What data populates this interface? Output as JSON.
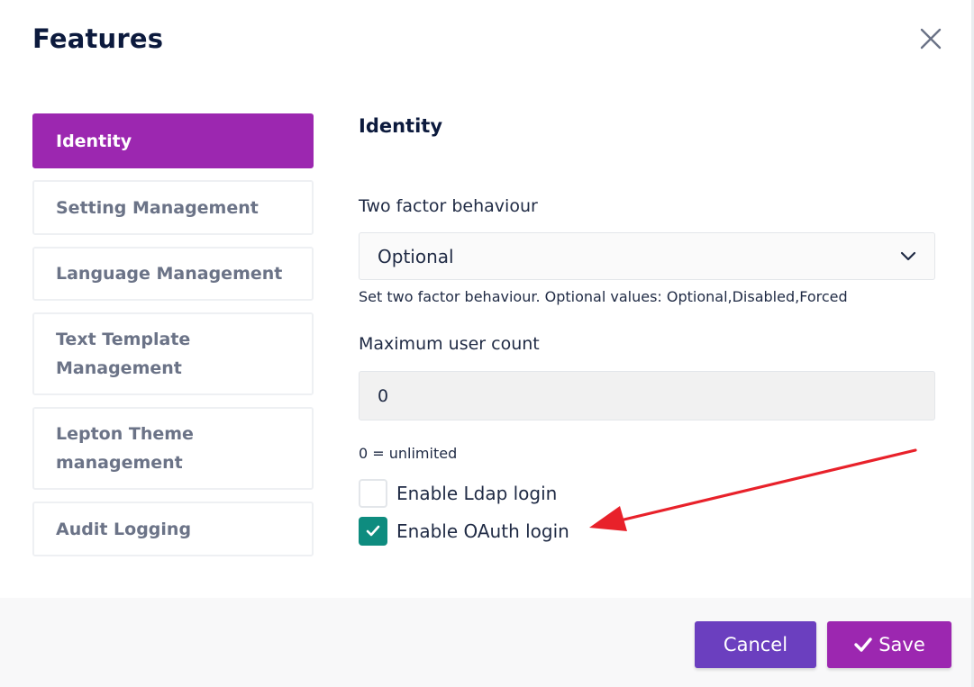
{
  "modal": {
    "title": "Features"
  },
  "sidebar": {
    "items": [
      {
        "label": "Identity",
        "active": true
      },
      {
        "label": "Setting Management",
        "active": false
      },
      {
        "label": "Language Management",
        "active": false
      },
      {
        "label": "Text Template Management",
        "active": false
      },
      {
        "label": "Lepton Theme management",
        "active": false
      },
      {
        "label": "Audit Logging",
        "active": false
      }
    ]
  },
  "content": {
    "section_title": "Identity",
    "two_factor": {
      "label": "Two factor behaviour",
      "selected": "Optional",
      "help": "Set two factor behaviour. Optional values: Optional,Disabled,Forced"
    },
    "max_users": {
      "label": "Maximum user count",
      "value": "0",
      "help": "0 = unlimited"
    },
    "checkboxes": [
      {
        "label": "Enable Ldap login",
        "checked": false
      },
      {
        "label": "Enable OAuth login",
        "checked": true
      }
    ]
  },
  "footer": {
    "cancel_label": "Cancel",
    "save_label": "Save"
  },
  "colors": {
    "primary": "#9c27b0",
    "cancel": "#6b3fbf",
    "check": "#0e8c7f",
    "annotation_arrow": "#e8212a"
  },
  "icons": {
    "close": "close-icon",
    "dropdown": "chevron-down-icon",
    "check": "check-icon",
    "save": "check-icon"
  }
}
